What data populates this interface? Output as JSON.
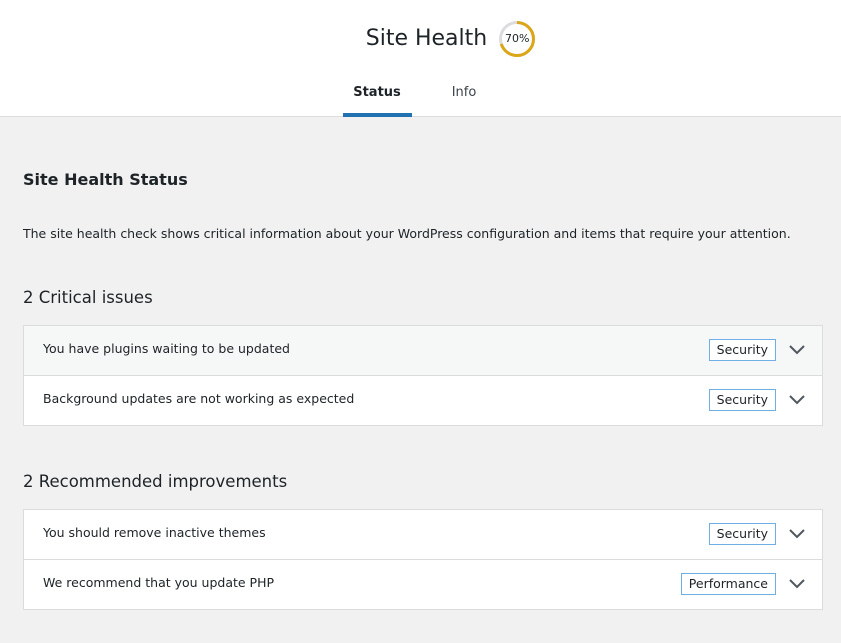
{
  "header": {
    "title": "Site Health",
    "score": {
      "value": 70,
      "label": "70%",
      "ring_color": "#dba617",
      "track_color": "#dcdcde"
    },
    "tabs": [
      {
        "label": "Status",
        "active": true
      },
      {
        "label": "Info",
        "active": false
      }
    ]
  },
  "main": {
    "heading": "Site Health Status",
    "intro": "The site health check shows critical information about your WordPress configuration and items that require your attention.",
    "groups": [
      {
        "title": "2 Critical issues",
        "items": [
          {
            "label": "You have plugins waiting to be updated",
            "badge": "Security",
            "icon": "chevron-down-icon"
          },
          {
            "label": "Background updates are not working as expected",
            "badge": "Security",
            "icon": "chevron-down-icon"
          }
        ]
      },
      {
        "title": "2 Recommended improvements",
        "items": [
          {
            "label": "You should remove inactive themes",
            "badge": "Security",
            "icon": "chevron-down-icon"
          },
          {
            "label": "We recommend that you update PHP",
            "badge": "Performance",
            "icon": "chevron-down-icon"
          }
        ]
      }
    ]
  },
  "colors": {
    "accent": "#2271b1",
    "badge_border": "#72aee6"
  }
}
